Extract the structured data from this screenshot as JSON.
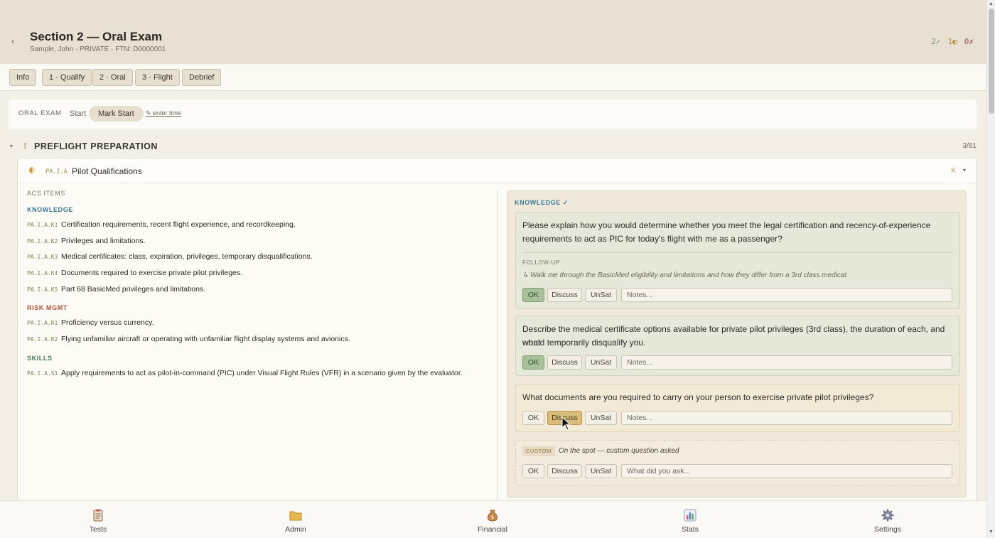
{
  "header": {
    "back_glyph": "‹",
    "title": "Section 2 — Oral Exam",
    "subtitle": "Sample, John · PRIVATE · FTN: D0000001",
    "tally_ok": "2✓",
    "tally_discuss": "1◐",
    "tally_unsat": "0✗"
  },
  "tabs": [
    "Info",
    "1 · Qualify",
    "2 · Oral",
    "3 · Flight",
    "Debrief"
  ],
  "startbar": {
    "label": "ORAL EXAM",
    "start": "Start",
    "mark_start": "Mark Start",
    "enter_time": "✎ enter time"
  },
  "section": {
    "caret": "▾",
    "numeral": "I",
    "name": "PREFLIGHT PREPARATION",
    "count": "3/81"
  },
  "task": {
    "code": "PA.I.A",
    "name": "Pilot Qualifications",
    "badge": "K",
    "caret": "▾"
  },
  "acs": {
    "title": "ACS ITEMS",
    "knowledge_label": "KNOWLEDGE",
    "risk_label": "RISK MGMT",
    "skills_label": "SKILLS",
    "knowledge": [
      {
        "code": "PA.I.A.K1",
        "text": "Certification requirements, recent flight experience, and recordkeeping."
      },
      {
        "code": "PA.I.A.K2",
        "text": "Privileges and limitations."
      },
      {
        "code": "PA.I.A.K3",
        "text": "Medical certificates: class, expiration, privileges, temporary disqualifications."
      },
      {
        "code": "PA.I.A.K4",
        "text": "Documents required to exercise private pilot privileges."
      },
      {
        "code": "PA.I.A.K5",
        "text": "Part 68 BasicMed privileges and limitations."
      }
    ],
    "risk": [
      {
        "code": "PA.I.A.R1",
        "text": "Proficiency versus currency."
      },
      {
        "code": "PA.I.A.R2",
        "text": "Flying unfamiliar aircraft or operating with unfamiliar flight display systems and avionics."
      }
    ],
    "skills": [
      {
        "code": "PA.I.A.S1",
        "text": "Apply requirements to act as pilot-in-command (PIC) under Visual Flight Rules (VFR) in a scenario given by the evaluator."
      }
    ]
  },
  "questions": {
    "header": "KNOWLEDGE ✓",
    "q1": {
      "line1": "Please explain how you would determine whether you meet the legal certification and recency-of-experience",
      "line2": "requirements to act as PIC for today's flight with me as a passenger?",
      "followup_label": "FOLLOW-UP",
      "followup": "↳ Walk me through the BasicMed eligibility and limitations and how they differ from a 3rd class medical.",
      "state": "OK"
    },
    "q2": {
      "line1": "Describe the medical certificate options available for private pilot privileges (3rd class), the duration of each, and what",
      "line2": "would temporarily disqualify you.",
      "state": "OK"
    },
    "q3": {
      "line1": "What documents are you required to carry on your person to exercise private pilot privileges?",
      "state": "Discuss"
    },
    "custom": {
      "badge": "CUSTOM",
      "text": "On the spot — custom question asked",
      "placeholder": "What did you ask..."
    },
    "buttons": {
      "ok": "OK",
      "discuss": "Discuss",
      "unsat": "UnSat"
    },
    "notes_placeholder": "Notes..."
  },
  "nav": [
    {
      "label": "Tests",
      "icon": "clipboard-icon"
    },
    {
      "label": "Admin",
      "icon": "folder-icon"
    },
    {
      "label": "Financial",
      "icon": "money-bag-icon"
    },
    {
      "label": "Stats",
      "icon": "bar-chart-icon"
    },
    {
      "label": "Settings",
      "icon": "gear-icon"
    }
  ],
  "colors": {
    "header_bg": "#e8e0d2",
    "ok_active": "#a8c19a",
    "discuss_active": "#d9bd7d",
    "accent_blue": "#3f7a94",
    "risk_red": "#b5513f",
    "skills_green": "#3f7a55"
  }
}
